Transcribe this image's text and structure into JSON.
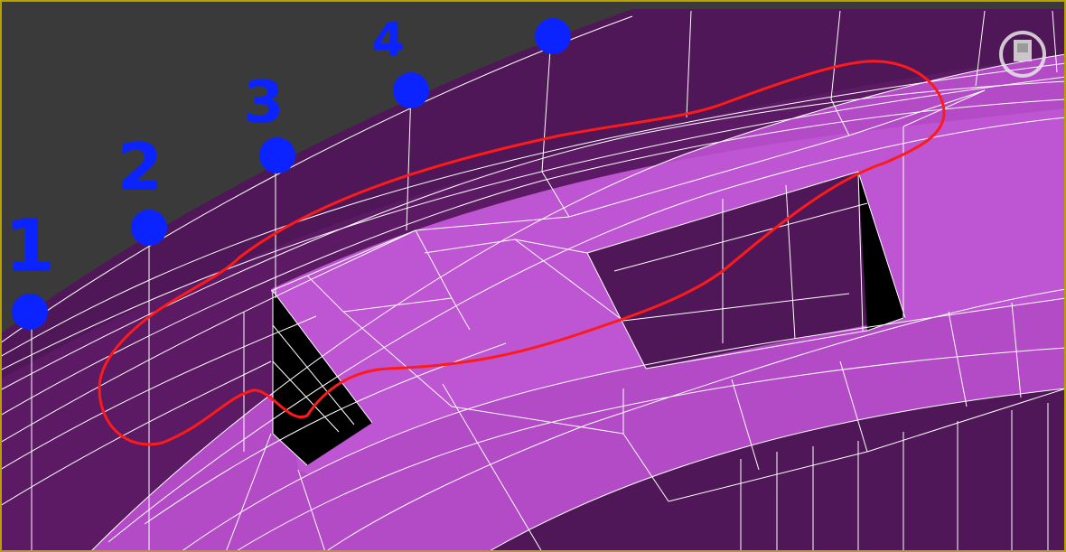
{
  "viewport": {
    "background_color": "#3a3a3a",
    "frame_color": "#b8a000",
    "mesh_dark_color": "#4f1757",
    "mesh_mid_color": "#5b1a63",
    "mesh_light_color": "#b34bc7",
    "mesh_lighter_color": "#be55d2",
    "wire_color": "#ffffff",
    "hole_color": "#000000",
    "annotation_outline_color": "#ff1a1a",
    "marker_color": "#0b24ff"
  },
  "markers": [
    {
      "label": "1",
      "name": "marker-1"
    },
    {
      "label": "2",
      "name": "marker-2"
    },
    {
      "label": "3",
      "name": "marker-3"
    },
    {
      "label": "4",
      "name": "marker-4"
    },
    {
      "label": "",
      "name": "marker-5"
    }
  ],
  "nav_gizmo": {
    "icon": "viewcube-icon"
  }
}
